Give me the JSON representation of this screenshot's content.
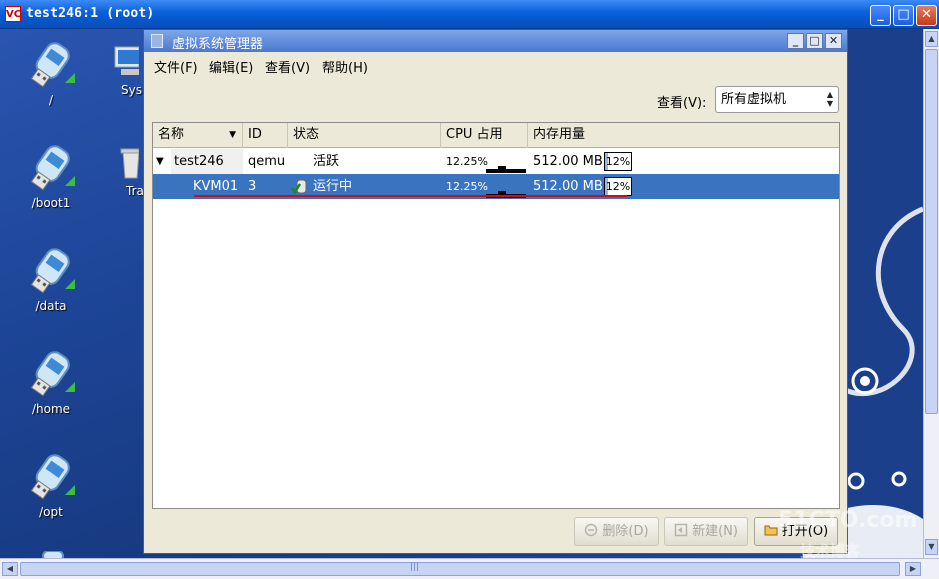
{
  "vnc": {
    "title": "test246:1 (root)",
    "logo_text": "VC",
    "buttons": [
      "_",
      "□",
      "✕"
    ]
  },
  "desktop": {
    "icons": [
      {
        "label": "/"
      },
      {
        "label": "/boot1"
      },
      {
        "label": "/data"
      },
      {
        "label": "/home"
      },
      {
        "label": "/opt"
      }
    ],
    "partial_icons": [
      {
        "label": "Sys"
      },
      {
        "label": "Tra"
      }
    ]
  },
  "window": {
    "title": "虚拟系统管理器",
    "controls": [
      "_",
      "□",
      "✕"
    ]
  },
  "menu": {
    "file": "文件(F)",
    "edit": "编辑(E)",
    "view": "查看(V)",
    "help": "帮助(H)"
  },
  "filter": {
    "label": "查看(V):",
    "selected": "所有虚拟机"
  },
  "table": {
    "headers": {
      "name": "名称",
      "id": "ID",
      "status": "状态",
      "cpu": "CPU 占用",
      "mem": "内存用量"
    },
    "host": {
      "name": "test246",
      "id": "qemu",
      "status": "活跃",
      "cpu": "12.25%",
      "mem": "512.00 MB",
      "mem_pct": "12%"
    },
    "vm": {
      "name": "KVM01",
      "id": "3",
      "status": "运行中",
      "cpu": "12.25%",
      "mem": "512.00 MB",
      "mem_pct": "12%"
    },
    "mem_fraction": 0.12
  },
  "buttons": {
    "delete": "删除(D)",
    "new": "新建(N)",
    "open": "打开(O)"
  },
  "colors": {
    "selection": "#3a74c0",
    "titlebar": "#0a5fd8"
  },
  "watermark": {
    "line1": "51CTO.com",
    "line2": "技术博客"
  }
}
